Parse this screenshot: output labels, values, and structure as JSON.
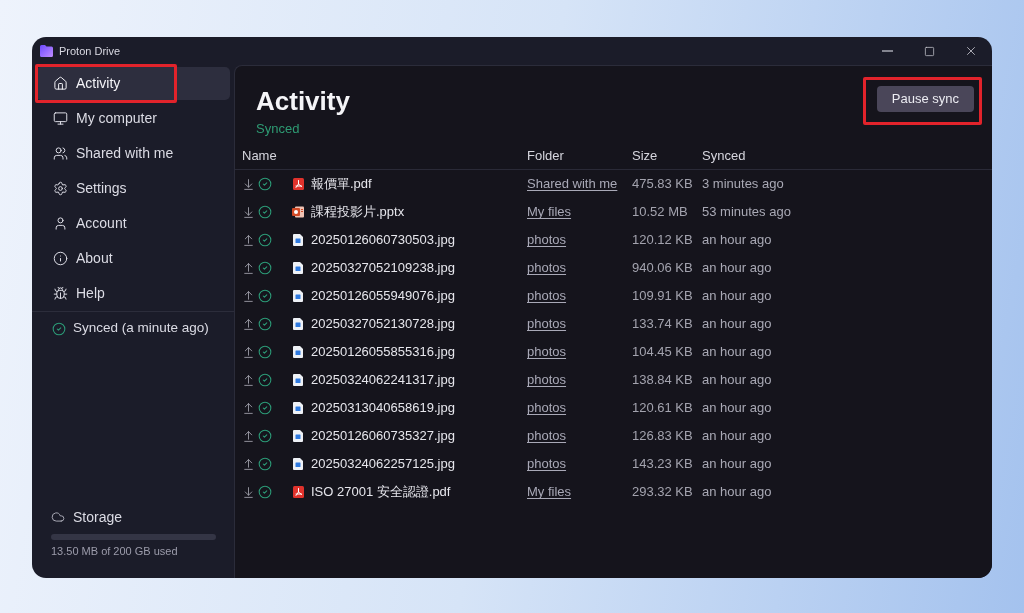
{
  "window": {
    "title": "Proton Drive"
  },
  "sidebar": {
    "items": [
      {
        "kind": "home",
        "label": "Activity",
        "selected": true,
        "highlighted": true
      },
      {
        "kind": "computer",
        "label": "My computer",
        "selected": false,
        "highlighted": false
      },
      {
        "kind": "shared",
        "label": "Shared with me",
        "selected": false,
        "highlighted": false
      },
      {
        "kind": "settings",
        "label": "Settings",
        "selected": false,
        "highlighted": false
      },
      {
        "kind": "account",
        "label": "Account",
        "selected": false,
        "highlighted": false
      },
      {
        "kind": "about",
        "label": "About",
        "selected": false,
        "highlighted": false
      },
      {
        "kind": "help",
        "label": "Help",
        "selected": false,
        "highlighted": false
      }
    ],
    "sync_status": {
      "label": "Synced (a minute ago)",
      "synced": true
    },
    "storage": {
      "label": "Storage",
      "level": 0,
      "usage": "13.50 MB of 200 GB used"
    }
  },
  "main": {
    "title": "Activity",
    "status": "Synced",
    "pause_button": {
      "label": "Pause sync",
      "highlighted": true
    }
  },
  "table": {
    "columns": [
      "Name",
      "Folder",
      "Size",
      "Synced"
    ],
    "rows": [
      {
        "uploaded": false,
        "synced": true,
        "kind": "pdf",
        "name": "報價單.pdf",
        "folder": "Shared with me",
        "size": "475.83 KB",
        "time": "3 minutes ago"
      },
      {
        "uploaded": false,
        "synced": true,
        "kind": "pptx",
        "name": "課程投影片.pptx",
        "folder": "My files",
        "size": "10.52 MB",
        "time": "53 minutes ago"
      },
      {
        "uploaded": true,
        "synced": true,
        "kind": "image",
        "name": "20250126060730503.jpg",
        "folder": "photos",
        "size": "120.12 KB",
        "time": "an hour ago"
      },
      {
        "uploaded": true,
        "synced": true,
        "kind": "image",
        "name": "20250327052109238.jpg",
        "folder": "photos",
        "size": "940.06 KB",
        "time": "an hour ago"
      },
      {
        "uploaded": true,
        "synced": true,
        "kind": "image",
        "name": "20250126055949076.jpg",
        "folder": "photos",
        "size": "109.91 KB",
        "time": "an hour ago"
      },
      {
        "uploaded": true,
        "synced": true,
        "kind": "image",
        "name": "20250327052130728.jpg",
        "folder": "photos",
        "size": "133.74 KB",
        "time": "an hour ago"
      },
      {
        "uploaded": true,
        "synced": true,
        "kind": "image",
        "name": "20250126055855316.jpg",
        "folder": "photos",
        "size": "104.45 KB",
        "time": "an hour ago"
      },
      {
        "uploaded": true,
        "synced": true,
        "kind": "image",
        "name": "20250324062241317.jpg",
        "folder": "photos",
        "size": "138.84 KB",
        "time": "an hour ago"
      },
      {
        "uploaded": true,
        "synced": true,
        "kind": "image",
        "name": "20250313040658619.jpg",
        "folder": "photos",
        "size": "120.61 KB",
        "time": "an hour ago"
      },
      {
        "uploaded": true,
        "synced": true,
        "kind": "image",
        "name": "20250126060735327.jpg",
        "folder": "photos",
        "size": "126.83 KB",
        "time": "an hour ago"
      },
      {
        "uploaded": true,
        "synced": true,
        "kind": "image",
        "name": "20250324062257125.jpg",
        "folder": "photos",
        "size": "143.23 KB",
        "time": "an hour ago"
      },
      {
        "uploaded": false,
        "synced": true,
        "kind": "pdf",
        "name": "ISO 27001 安全認證.pdf",
        "folder": "My files",
        "size": "293.32 KB",
        "time": "an hour ago"
      }
    ]
  }
}
